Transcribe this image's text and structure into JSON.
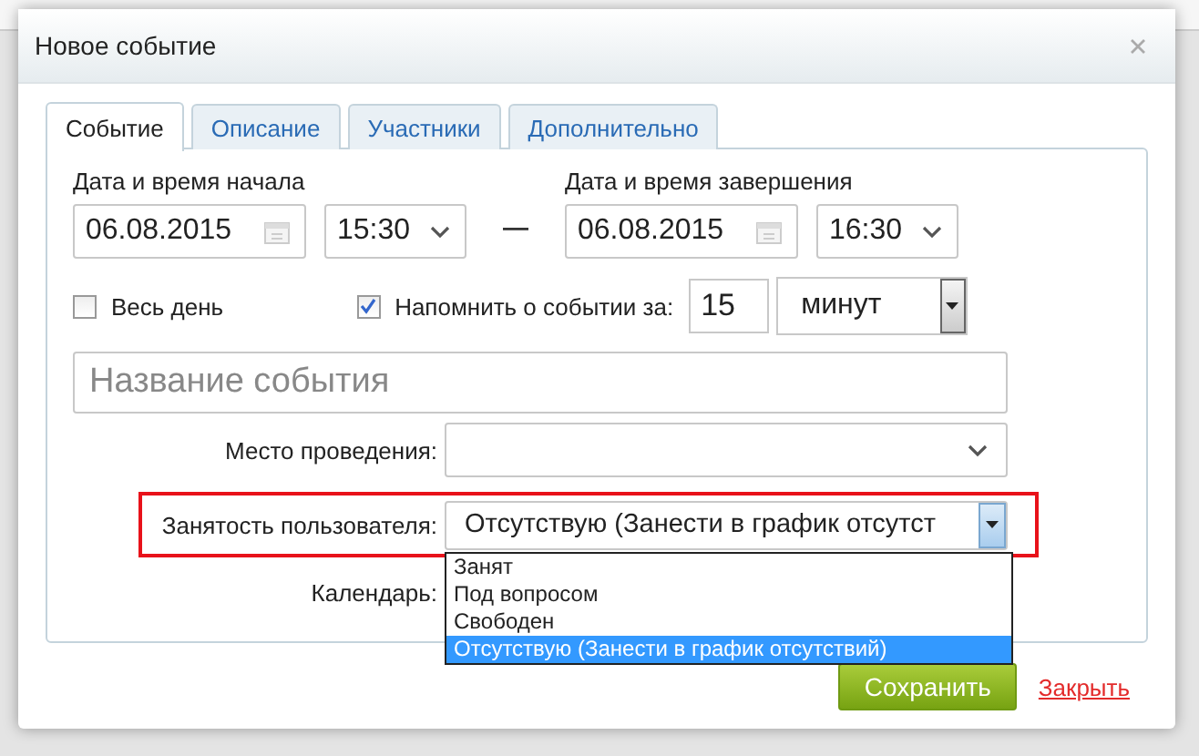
{
  "dialog": {
    "title": "Новое событие",
    "tabs": [
      {
        "label": "Событие",
        "selected": true
      },
      {
        "label": "Описание",
        "selected": false
      },
      {
        "label": "Участники",
        "selected": false
      },
      {
        "label": "Дополнительно",
        "selected": false
      }
    ],
    "start": {
      "label": "Дата и время начала",
      "date": "06.08.2015",
      "time": "15:30"
    },
    "end": {
      "label": "Дата и время завершения",
      "date": "06.08.2015",
      "time": "16:30"
    },
    "all_day": {
      "label": "Весь день",
      "checked": false
    },
    "reminder": {
      "label": "Напомнить о событии за:",
      "checked": true,
      "value": "15",
      "unit": "минут"
    },
    "name_field": {
      "placeholder": "Название события"
    },
    "location": {
      "label": "Место проведения:"
    },
    "busy": {
      "label": "Занятость пользователя:",
      "value": "Отсутствую (Занести в график отсутст",
      "highlighted": true,
      "expanded": true,
      "options": [
        {
          "label": "Занят",
          "selected": false
        },
        {
          "label": "Под вопросом",
          "selected": false
        },
        {
          "label": "Свободен",
          "selected": false
        },
        {
          "label": "Отсутствую (Занести в график отсутствий)",
          "selected": true
        }
      ]
    },
    "calendar": {
      "label": "Календарь:"
    },
    "save": "Сохранить",
    "close": "Закрыть"
  }
}
